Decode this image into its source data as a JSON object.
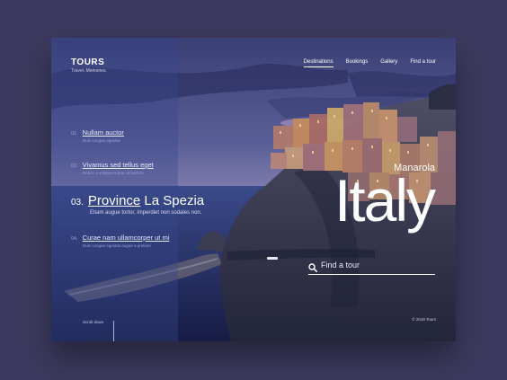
{
  "brand": {
    "name": "TOURS",
    "tagline": "Travel. Memories."
  },
  "nav": [
    {
      "label": "Destinations",
      "active": true
    },
    {
      "label": "Bookings"
    },
    {
      "label": "Gallery"
    },
    {
      "label": "Find a tour"
    }
  ],
  "list": [
    {
      "num": "01.",
      "title": "Nullam auctor",
      "desc": "Duis congue egestas"
    },
    {
      "num": "02.",
      "title": "Vivamus sed tellus eget",
      "desc": "Donec a volutpat turpis, id facilisis"
    },
    {
      "num": "03.",
      "title_main": "Province",
      "title_rest": " La Spezia",
      "desc": "Etiam augue tortor, imperdiet non sodales non."
    },
    {
      "num": "04.",
      "title": "Curae nam ullamcorper ut mi",
      "desc": "Duis congue egestas augue a pretium"
    }
  ],
  "scroll_label": "Scroll down",
  "hero": {
    "city": "Manarola",
    "country": "Italy"
  },
  "search": {
    "placeholder": "Find a tour",
    "value": ""
  },
  "copyright": "© 2019 Tours",
  "colors": {
    "background": "#3b3a5e",
    "panel": "#37468c",
    "text": "#ffffff"
  }
}
